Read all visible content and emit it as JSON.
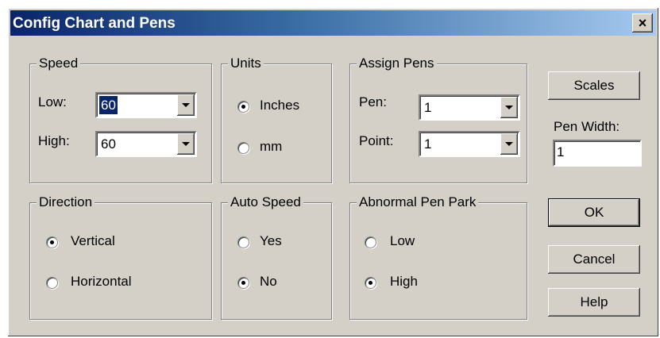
{
  "window": {
    "title": "Config Chart and Pens",
    "close_glyph": "×",
    "close_icon": "close-icon"
  },
  "speed": {
    "legend": "Speed",
    "low_label": "Low:",
    "low_value": "60",
    "high_label": "High:",
    "high_value": "60"
  },
  "units": {
    "legend": "Units",
    "options": [
      "Inches",
      "mm"
    ],
    "selected": "Inches"
  },
  "assign_pens": {
    "legend": "Assign Pens",
    "pen_label": "Pen:",
    "pen_value": "1",
    "point_label": "Point:",
    "point_value": "1"
  },
  "direction": {
    "legend": "Direction",
    "options": [
      "Vertical",
      "Horizontal"
    ],
    "selected": "Vertical"
  },
  "auto_speed": {
    "legend": "Auto Speed",
    "options": [
      "Yes",
      "No"
    ],
    "selected": "No"
  },
  "abnormal_pen_park": {
    "legend": "Abnormal Pen Park",
    "options": [
      "Low",
      "High"
    ],
    "selected": "High"
  },
  "buttons": {
    "scales": "Scales",
    "ok": "OK",
    "cancel": "Cancel",
    "help": "Help"
  },
  "pen_width": {
    "label": "Pen Width:",
    "value": "1"
  },
  "colors": {
    "title_start": "#0a246a",
    "title_end": "#a6caf0",
    "face": "#d4d0c8",
    "selection": "#0a246a"
  }
}
